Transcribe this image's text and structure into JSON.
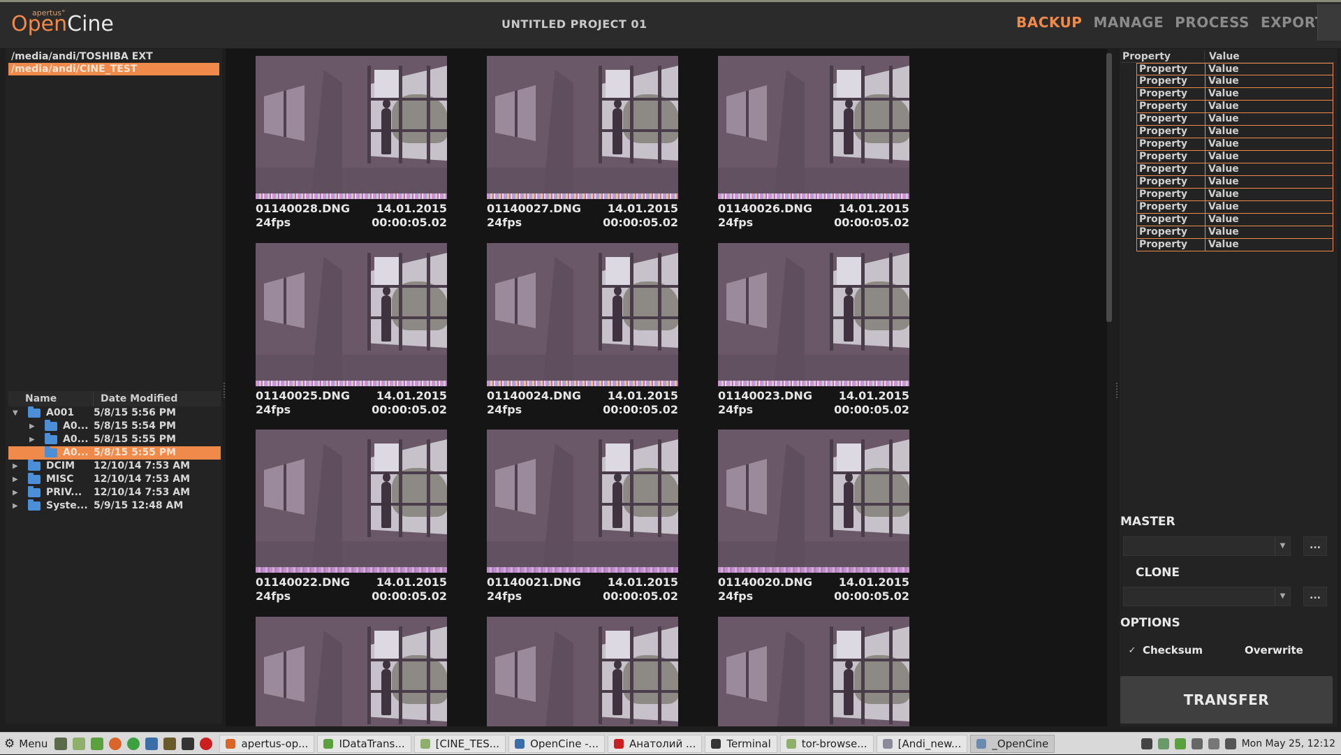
{
  "app": {
    "logo_brand": "apertus°",
    "logo_open": "Open",
    "logo_cine": "Cine",
    "project_title": "UNTITLED PROJECT 01",
    "accent_color": "#f08a4b"
  },
  "nav": {
    "backup": "BACKUP",
    "manage": "MANAGE",
    "process": "PROCESS",
    "export": "EXPORT",
    "active": "BACKUP"
  },
  "drives": [
    {
      "path": "/media/andi/TOSHIBA EXT",
      "selected": false
    },
    {
      "path": "/media/andi/CINE_TEST",
      "selected": true
    }
  ],
  "tree": {
    "col_name": "Name",
    "col_date": "Date Modified",
    "rows": [
      {
        "name": "A001",
        "date": "5/8/15 5:56 PM",
        "expanded": true
      },
      {
        "name": "A0...",
        "date": "5/8/15 5:54 PM"
      },
      {
        "name": "A0...",
        "date": "5/8/15 5:55 PM"
      },
      {
        "name": "A0...",
        "date": "5/8/15 5:55 PM",
        "selected": true
      },
      {
        "name": "DCIM",
        "date": "12/10/14 7:53 AM"
      },
      {
        "name": "MISC",
        "date": "12/10/14 7:53 AM"
      },
      {
        "name": "PRIV...",
        "date": "12/10/14 7:53 AM"
      },
      {
        "name": "Syste...",
        "date": "5/9/15 12:48 AM"
      }
    ]
  },
  "clips": [
    {
      "file": "01140028.DNG",
      "date": "14.01.2015",
      "fps": "24fps",
      "duration": "00:00:05.02"
    },
    {
      "file": "01140027.DNG",
      "date": "14.01.2015",
      "fps": "24fps",
      "duration": "00:00:05.02"
    },
    {
      "file": "01140026.DNG",
      "date": "14.01.2015",
      "fps": "24fps",
      "duration": "00:00:05.02"
    },
    {
      "file": "01140025.DNG",
      "date": "14.01.2015",
      "fps": "24fps",
      "duration": "00:00:05.02"
    },
    {
      "file": "01140024.DNG",
      "date": "14.01.2015",
      "fps": "24fps",
      "duration": "00:00:05.02"
    },
    {
      "file": "01140023.DNG",
      "date": "14.01.2015",
      "fps": "24fps",
      "duration": "00:00:05.02"
    },
    {
      "file": "01140022.DNG",
      "date": "14.01.2015",
      "fps": "24fps",
      "duration": "00:00:05.02"
    },
    {
      "file": "01140021.DNG",
      "date": "14.01.2015",
      "fps": "24fps",
      "duration": "00:00:05.02"
    },
    {
      "file": "01140020.DNG",
      "date": "14.01.2015",
      "fps": "24fps",
      "duration": "00:00:05.02"
    }
  ],
  "properties": {
    "col_property": "Property",
    "col_value": "Value",
    "rows": [
      {
        "p": "Property",
        "v": "Value"
      },
      {
        "p": "Property",
        "v": "Value"
      },
      {
        "p": "Property",
        "v": "Value"
      },
      {
        "p": "Property",
        "v": "Value"
      },
      {
        "p": "Property",
        "v": "Value"
      },
      {
        "p": "Property",
        "v": "Value"
      },
      {
        "p": "Property",
        "v": "Value"
      },
      {
        "p": "Property",
        "v": "Value"
      },
      {
        "p": "Property",
        "v": "Value"
      },
      {
        "p": "Property",
        "v": "Value"
      },
      {
        "p": "Property",
        "v": "Value"
      },
      {
        "p": "Property",
        "v": "Value"
      },
      {
        "p": "Property",
        "v": "Value"
      },
      {
        "p": "Property",
        "v": "Value"
      },
      {
        "p": "Property",
        "v": "Value"
      }
    ]
  },
  "backup": {
    "master_label": "MASTER",
    "clone_label": "CLONE",
    "options_label": "OPTIONS",
    "browse_label": "...",
    "checksum_label": "Checksum",
    "checksum_checked": true,
    "overwrite_label": "Overwrite",
    "overwrite_checked": false,
    "transfer_label": "TRANSFER"
  },
  "taskbar": {
    "menu_label": "Menu",
    "tasks": [
      {
        "label": "apertus-op...",
        "icon": "browser-icon",
        "color": "#d9652a"
      },
      {
        "label": "IDataTrans...",
        "icon": "qt-icon",
        "color": "#5aa03c"
      },
      {
        "label": "[CINE_TES...",
        "icon": "folder-icon",
        "color": "#8fb06a"
      },
      {
        "label": "OpenCine -...",
        "icon": "code-icon",
        "color": "#3a6ea8"
      },
      {
        "label": "Анатолий ...",
        "icon": "opera-icon",
        "color": "#cc2020"
      },
      {
        "label": "Terminal",
        "icon": "terminal-icon",
        "color": "#333333"
      },
      {
        "label": "tor-browse...",
        "icon": "folder-icon",
        "color": "#8fb06a"
      },
      {
        "label": "[Andi_new...",
        "icon": "disc-icon",
        "color": "#8a8a9a"
      },
      {
        "label": "_OpenCine",
        "icon": "window-icon",
        "color": "#6a8ab0",
        "active": true
      }
    ],
    "clock": "Mon May 25, 12:12"
  }
}
